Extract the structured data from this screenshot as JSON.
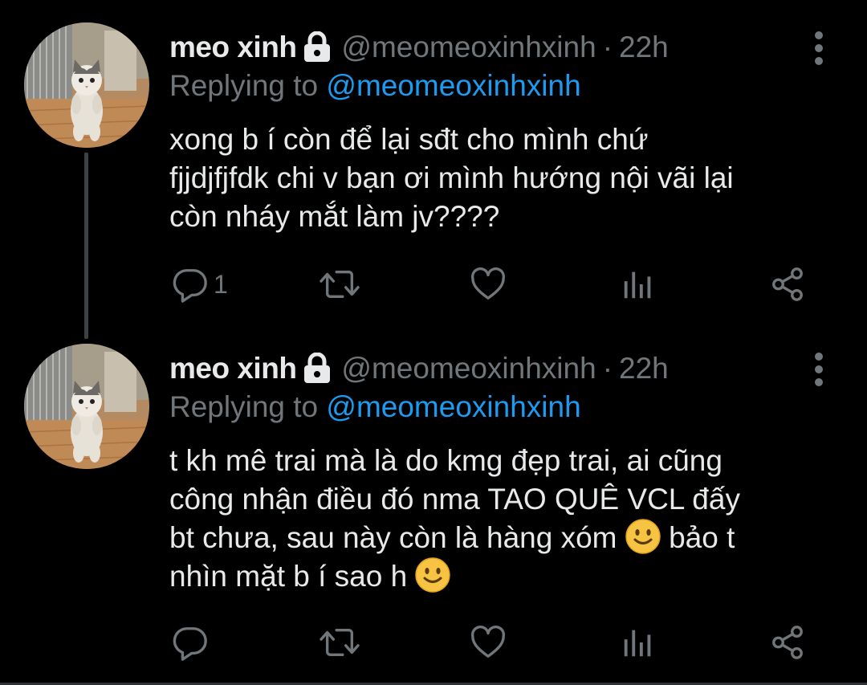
{
  "colors": {
    "background": "#000000",
    "text": "#e7e9ea",
    "muted": "#71767b",
    "link": "#1d9bf0"
  },
  "tweets": [
    {
      "display_name": "meo xinh",
      "handle": "@meomeoxinhxinh",
      "separator": "·",
      "time": "22h",
      "replying_label": "Replying to",
      "replying_to": "@meomeoxinhxinh",
      "lines": [
        "xong b í còn để lại sđt cho mình chứ",
        "fjjdjfjfdk chi v bạn ơi mình hướng nội vãi lại",
        "còn nháy mắt làm jv????"
      ],
      "reply_count": "1",
      "icons": [
        "lock-icon",
        "more-icon",
        "reply-icon",
        "retweet-icon",
        "like-icon",
        "views-icon",
        "share-icon"
      ]
    },
    {
      "display_name": "meo xinh",
      "handle": "@meomeoxinhxinh",
      "separator": "·",
      "time": "22h",
      "replying_label": "Replying to",
      "replying_to": "@meomeoxinhxinh",
      "lines": [
        "t kh mê trai mà là do kmg đẹp trai, ai cũng",
        "công nhận điều đó nma TAO QUÊ VCL đấy",
        "bt chưa, sau này còn là hàng xóm",
        "bảo t",
        "nhìn mặt b í sao h"
      ],
      "emoji": "slightly-smiling-face",
      "reply_count": "",
      "icons": [
        "lock-icon",
        "more-icon",
        "reply-icon",
        "retweet-icon",
        "like-icon",
        "views-icon",
        "share-icon"
      ]
    }
  ]
}
